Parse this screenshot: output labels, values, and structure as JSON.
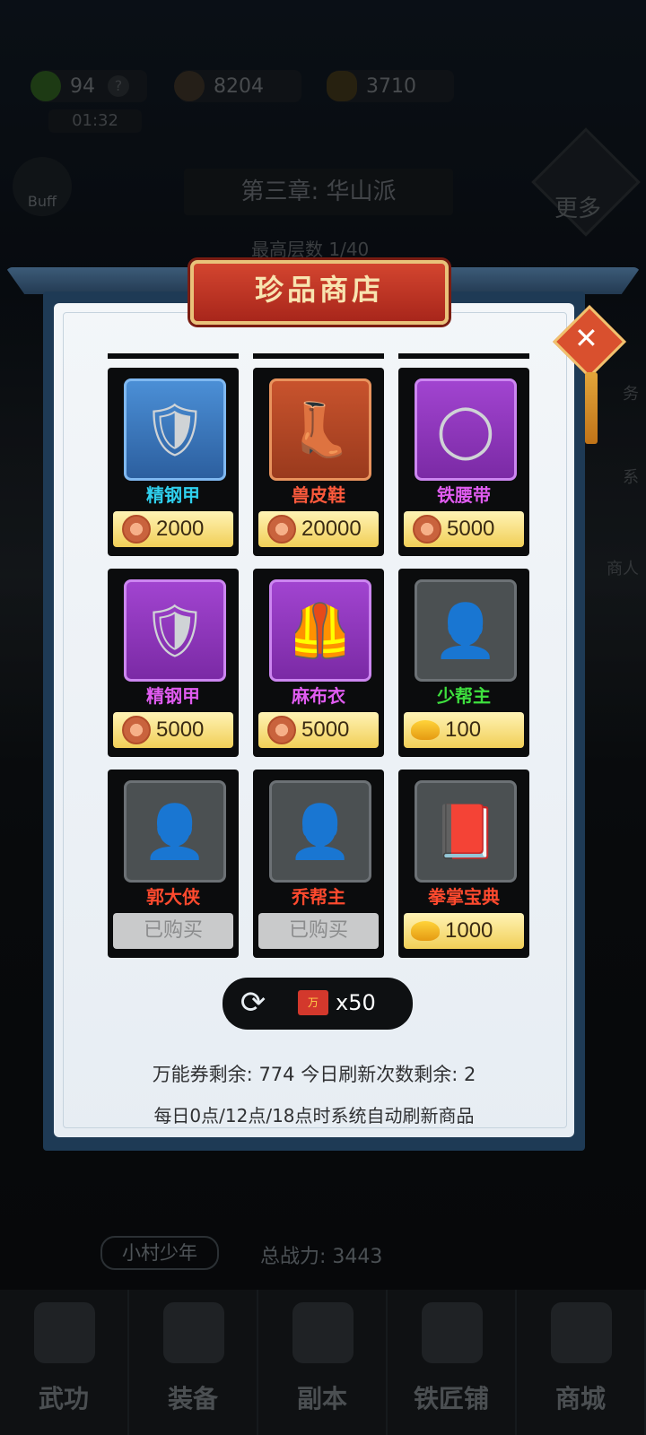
{
  "status": {
    "stamina": "94",
    "copper": "8204",
    "gold": "3710",
    "timer": "01:32",
    "buff_label": "Buff",
    "more_label": "更多"
  },
  "chapter": {
    "title": "第三章: 华山派",
    "floor": "最高层数 1/40"
  },
  "side_labels": [
    "务",
    "系",
    "商人"
  ],
  "shop": {
    "title": "珍品商店",
    "items": [
      {
        "name": "精钢甲",
        "name_color": "#2fd0ee",
        "quality": "blue",
        "glyph": "🛡",
        "price": "2000",
        "currency": "copper",
        "bought": false
      },
      {
        "name": "兽皮鞋",
        "name_color": "#ff5a3c",
        "quality": "orange",
        "glyph": "👢",
        "price": "20000",
        "currency": "copper",
        "bought": false
      },
      {
        "name": "铁腰带",
        "name_color": "#e05cf0",
        "quality": "purple",
        "glyph": "◯",
        "price": "5000",
        "currency": "copper",
        "bought": false
      },
      {
        "name": "精钢甲",
        "name_color": "#e05cf0",
        "quality": "purple",
        "glyph": "🛡",
        "price": "5000",
        "currency": "copper",
        "bought": false
      },
      {
        "name": "麻布衣",
        "name_color": "#e05cf0",
        "quality": "purple",
        "glyph": "🦺",
        "price": "5000",
        "currency": "copper",
        "bought": false
      },
      {
        "name": "少帮主",
        "name_color": "#3ee03e",
        "quality": "gray",
        "glyph": "👤",
        "price": "100",
        "currency": "gold",
        "bought": false
      },
      {
        "name": "郭大侠",
        "name_color": "#ff4a2e",
        "quality": "gray",
        "glyph": "👤",
        "price": "",
        "currency": "",
        "bought": true
      },
      {
        "name": "乔帮主",
        "name_color": "#ff4a2e",
        "quality": "gray",
        "glyph": "👤",
        "price": "",
        "currency": "",
        "bought": true
      },
      {
        "name": "拳掌宝典",
        "name_color": "#ff4a2e",
        "quality": "gray",
        "glyph": "📕",
        "price": "1000",
        "currency": "gold",
        "bought": false
      }
    ],
    "bought_label": "已购买",
    "refresh_cost": "x50",
    "ticket_label": "万",
    "remaining_line": "万能券剩余: 774   今日刷新次数剩余: 2",
    "auto_refresh_line": "每日0点/12点/18点时系统自动刷新商品"
  },
  "hero": {
    "name": "小村少年",
    "power": "总战力:  3443"
  },
  "nav": [
    "武功",
    "装备",
    "副本",
    "铁匠铺",
    "商城"
  ]
}
